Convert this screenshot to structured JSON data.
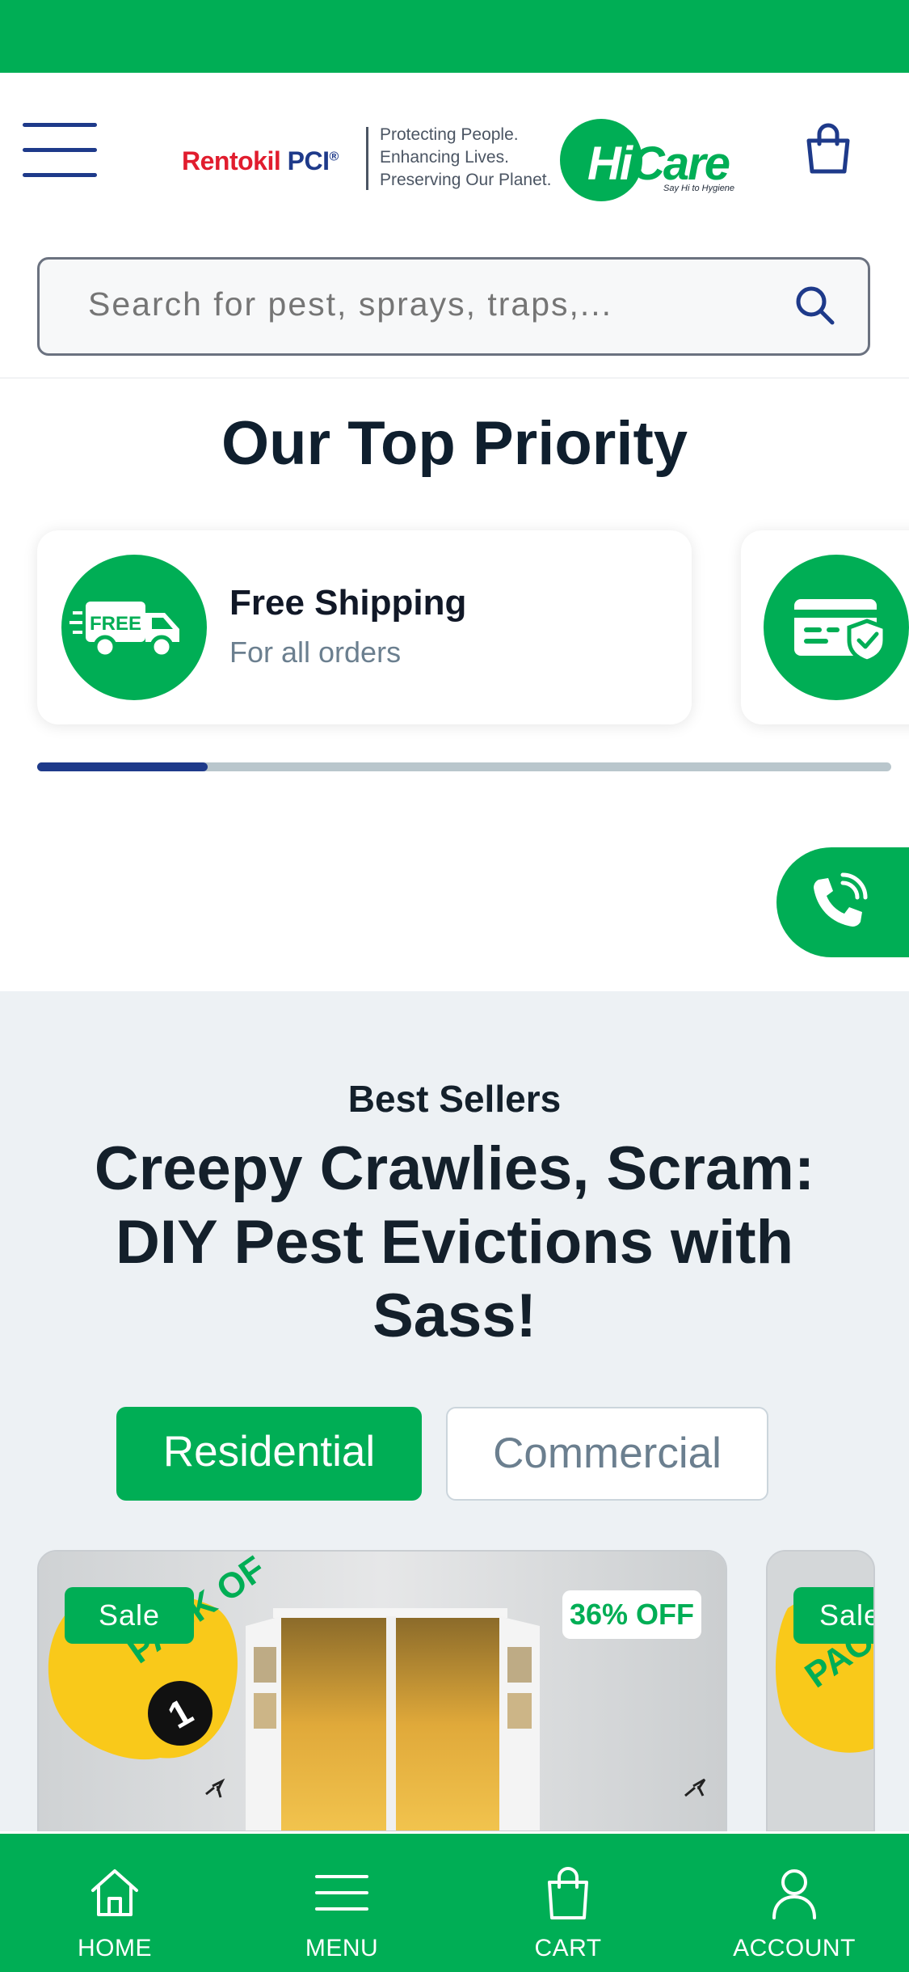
{
  "header": {
    "brand_rentokil_a": "Rentokil",
    "brand_rentokil_b": "PCI",
    "brand_mark": "®",
    "tagline": [
      "Protecting People.",
      "Enhancing Lives.",
      "Preserving Our Planet."
    ],
    "brand_hicare_a": "Hi",
    "brand_hicare_b": "Care",
    "brand_hicare_sub": "Say Hi to Hygiene",
    "menu_icon": "hamburger-icon",
    "cart_icon": "shopping-bag-icon"
  },
  "search": {
    "placeholder": "Search for pest, sprays, traps,...",
    "icon": "search-icon"
  },
  "priority": {
    "title": "Our Top Priority",
    "cards": [
      {
        "title": "Free Shipping",
        "subtitle": "For all orders",
        "icon": "free-delivery-truck-icon",
        "icon_text": "FREE"
      },
      {
        "icon": "secure-payment-card-icon"
      }
    ],
    "slider_progress": 0.2
  },
  "call_button": {
    "icon": "phone-call-icon"
  },
  "best_sellers": {
    "kicker": "Best Sellers",
    "title": "Creepy Crawlies, Scram: DIY Pest Evictions with Sass!",
    "tabs": [
      {
        "label": "Residential",
        "active": true
      },
      {
        "label": "Commercial",
        "active": false
      }
    ],
    "products": [
      {
        "badge": "Sale",
        "discount": "36% OFF",
        "pack_label": "PACK OF",
        "pack_count": "1"
      },
      {
        "badge": "Sale",
        "pack_label": "PACK"
      }
    ]
  },
  "bottom_nav": [
    {
      "label": "HOME",
      "icon": "home-icon"
    },
    {
      "label": "MENU",
      "icon": "menu-icon"
    },
    {
      "label": "CART",
      "icon": "shopping-bag-icon"
    },
    {
      "label": "ACCOUNT",
      "icon": "user-icon"
    }
  ],
  "colors": {
    "brand_green": "#00AE55",
    "brand_navy": "#1E3A8A",
    "rentokil_red": "#E11D2E",
    "section_bg": "#EDF1F4"
  }
}
